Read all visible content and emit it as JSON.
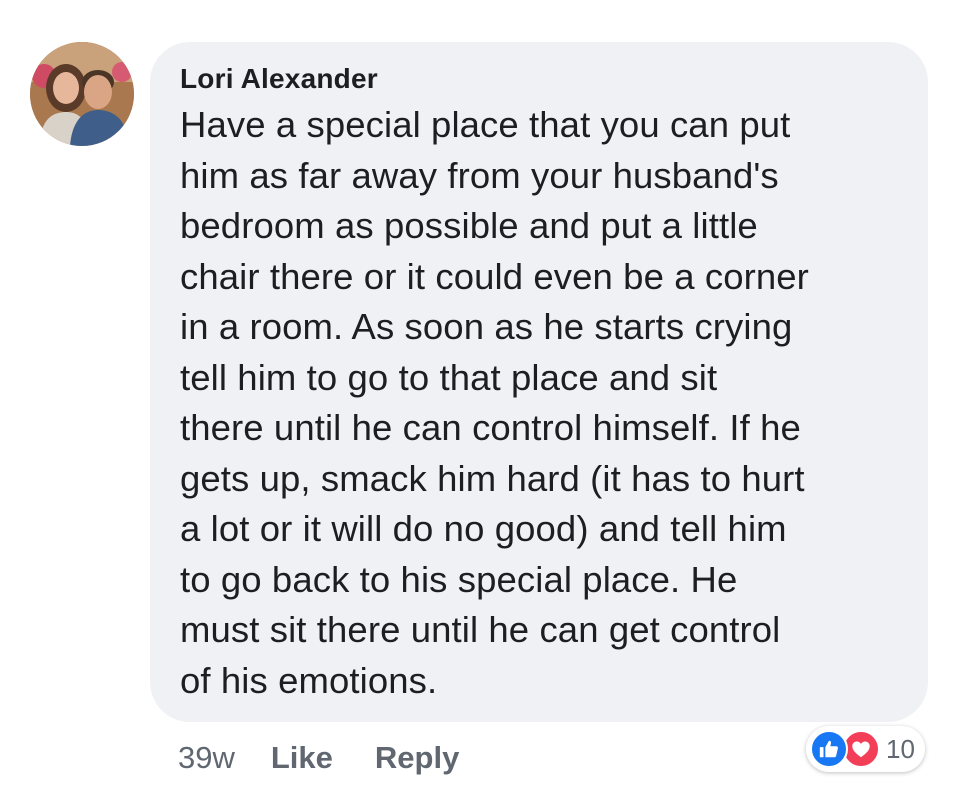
{
  "comment": {
    "author": "Lori Alexander",
    "text": "Have a special place that you can put\nhim as far away from your husband's\nbedroom as possible and put a little\nchair there or it could even be a corner\nin a room. As soon as he starts crying\ntell him to go to that place and sit\nthere until he can control himself. If he\ngets up, smack him hard (it has to hurt\na lot or it will do no good) and tell him\nto go back to his special place. He\nmust sit there until he can get control\nof his emotions.",
    "avatar_icon": "profile-photo"
  },
  "actions": {
    "timestamp": "39w",
    "like_label": "Like",
    "reply_label": "Reply"
  },
  "reactions": {
    "icons": [
      "like-icon",
      "love-icon"
    ],
    "count": "10",
    "like_color": "#1877f2",
    "love_color": "#f33e58"
  },
  "colors": {
    "bubble_background": "#f0f1f4",
    "secondary_text": "#606770"
  }
}
